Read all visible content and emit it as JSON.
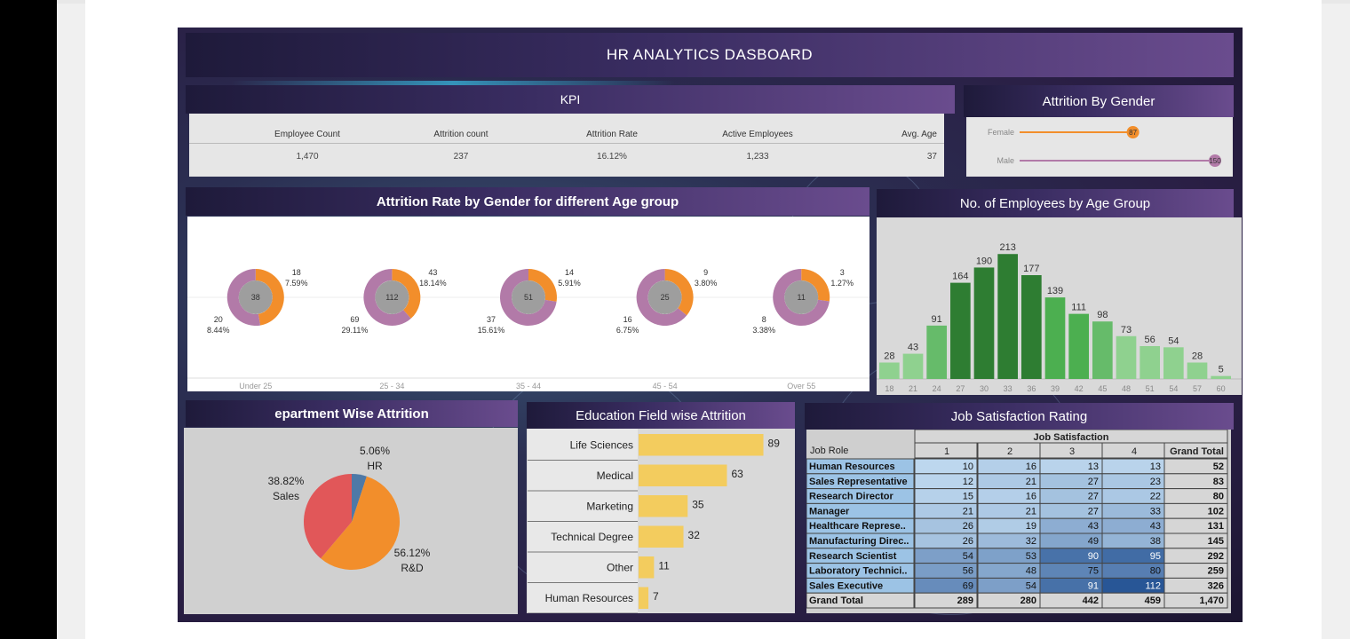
{
  "dashboard": {
    "title": "HR ANALYTICS DASBOARD"
  },
  "kpi": {
    "title": "KPI",
    "items": [
      {
        "label": "Employee Count",
        "value": "1,470"
      },
      {
        "label": "Attrition count",
        "value": "237"
      },
      {
        "label": "Attrition Rate",
        "value": "16.12%"
      },
      {
        "label": "Active Employees",
        "value": "1,233"
      },
      {
        "label": "Avg. Age",
        "value": "37"
      }
    ]
  },
  "colors": {
    "female": "#f28e2b",
    "male": "#b27aa8",
    "green_dark": "#2e7d32",
    "green_light": "#8fd18f",
    "pie_hr": "#4e79a7",
    "pie_sales": "#e15759",
    "pie_rd": "#f28e2b",
    "edu_bar": "#f3cc5e"
  },
  "chart_data": [
    {
      "id": "gender",
      "type": "scatter",
      "title": "Attrition By Gender",
      "categories": [
        "Female",
        "Male"
      ],
      "values": [
        87,
        150
      ],
      "xlim": [
        0,
        150
      ]
    },
    {
      "id": "age_gender",
      "type": "pie",
      "title": "Attrition Rate by Gender for different Age group",
      "groups": [
        {
          "label": "Under 25",
          "total": "38",
          "female": 18,
          "female_pct": "7.59%",
          "male": 20,
          "male_pct": "8.44%"
        },
        {
          "label": "25 - 34",
          "total": "112",
          "female": 43,
          "female_pct": "18.14%",
          "male": 69,
          "male_pct": "29.11%"
        },
        {
          "label": "35 - 44",
          "total": "51",
          "female": 14,
          "female_pct": "5.91%",
          "male": 37,
          "male_pct": "15.61%"
        },
        {
          "label": "45 - 54",
          "total": "25",
          "female": 9,
          "female_pct": "3.80%",
          "male": 16,
          "male_pct": "6.75%"
        },
        {
          "label": "Over 55",
          "total": "11",
          "female": 3,
          "female_pct": "1.27%",
          "male": 8,
          "male_pct": "3.38%"
        }
      ]
    },
    {
      "id": "age_hist",
      "type": "bar",
      "title": "No. of Employees by Age Group",
      "categories": [
        "18",
        "21",
        "24",
        "27",
        "30",
        "33",
        "36",
        "39",
        "42",
        "45",
        "48",
        "51",
        "54",
        "57",
        "60"
      ],
      "values": [
        28,
        43,
        91,
        164,
        190,
        213,
        177,
        139,
        111,
        98,
        73,
        56,
        54,
        28,
        5
      ],
      "ylim": [
        0,
        230
      ]
    },
    {
      "id": "dept",
      "type": "pie",
      "title": "epartment Wise Attrition",
      "slices": [
        {
          "name": "HR",
          "value": 5.06,
          "label": "5.06%"
        },
        {
          "name": "R&D",
          "value": 56.12,
          "label": "56.12%"
        },
        {
          "name": "Sales",
          "value": 38.82,
          "label": "38.82%"
        }
      ]
    },
    {
      "id": "edu",
      "type": "bar",
      "title": "Education Field wise Attrition",
      "categories": [
        "Life Sciences",
        "Medical",
        "Marketing",
        "Technical Degree",
        "Other",
        "Human Resources"
      ],
      "values": [
        89,
        63,
        35,
        32,
        11,
        7
      ],
      "xlim": [
        0,
        95
      ]
    },
    {
      "id": "job",
      "type": "table",
      "title": "Job Satisfaction Rating",
      "group_header": "Job Satisfaction",
      "row_header": "Job Role",
      "columns": [
        "1",
        "2",
        "3",
        "4",
        "Grand Total"
      ],
      "rows": [
        {
          "role": "Human Resources",
          "values": [
            10,
            16,
            13,
            13
          ],
          "total": "52"
        },
        {
          "role": "Sales Representative",
          "values": [
            12,
            21,
            27,
            23
          ],
          "total": "83"
        },
        {
          "role": "Research Director",
          "values": [
            15,
            16,
            27,
            22
          ],
          "total": "80"
        },
        {
          "role": "Manager",
          "values": [
            21,
            21,
            27,
            33
          ],
          "total": "102"
        },
        {
          "role": "Healthcare Represe..",
          "values": [
            26,
            19,
            43,
            43
          ],
          "total": "131"
        },
        {
          "role": "Manufacturing Direc..",
          "values": [
            26,
            32,
            49,
            38
          ],
          "total": "145"
        },
        {
          "role": "Research Scientist",
          "values": [
            54,
            53,
            90,
            95
          ],
          "total": "292"
        },
        {
          "role": "Laboratory Technici..",
          "values": [
            56,
            48,
            75,
            80
          ],
          "total": "259"
        },
        {
          "role": "Sales Executive",
          "values": [
            69,
            54,
            91,
            112
          ],
          "total": "326"
        }
      ],
      "grand_total": {
        "role": "Grand Total",
        "values": [
          "289",
          "280",
          "442",
          "459"
        ],
        "total": "1,470"
      }
    }
  ]
}
